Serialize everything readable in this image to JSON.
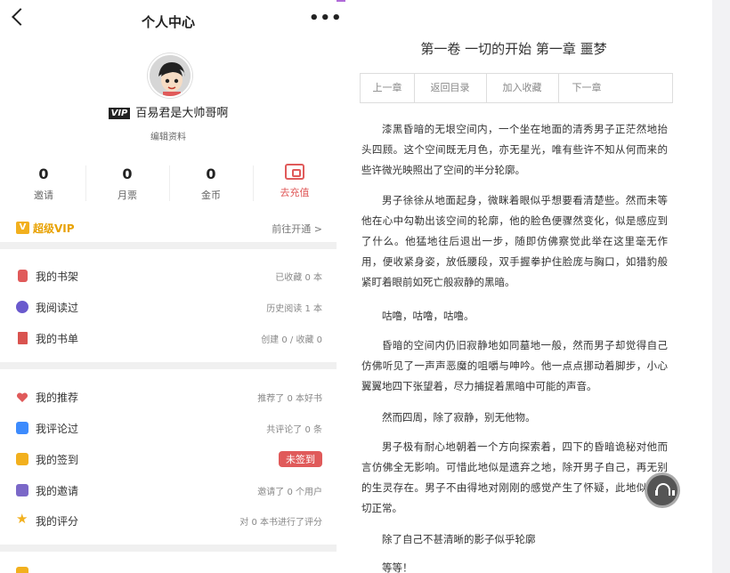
{
  "header": {
    "title": "个人中心"
  },
  "profile": {
    "vip_tag": "VIP",
    "username": "百易君是大帅哥啊",
    "edit_label": "编辑资料"
  },
  "stats": [
    {
      "value": "0",
      "label": "邀请"
    },
    {
      "value": "0",
      "label": "月票"
    },
    {
      "value": "0",
      "label": "金币"
    }
  ],
  "recharge": {
    "label": "去充值"
  },
  "vip": {
    "label": "超级VIP",
    "action": "前往开通 >"
  },
  "menu_group1": [
    {
      "label": "我的书架",
      "value": "已收藏 0 本",
      "icon": "bookshelf-icon",
      "color": "#e05a5a"
    },
    {
      "label": "我阅读过",
      "value": "历史阅读 1 本",
      "icon": "clock-icon",
      "color": "#6a5acd"
    },
    {
      "label": "我的书单",
      "value": "创建 0 / 收藏 0",
      "icon": "bookmark-icon",
      "color": "#d9534f"
    }
  ],
  "menu_group2": [
    {
      "label": "我的推荐",
      "value": "推荐了 0 本好书",
      "icon": "heart-icon",
      "color": "#e05a5a"
    },
    {
      "label": "我评论过",
      "value": "共评论了 0 条",
      "icon": "comment-icon",
      "color": "#3d8bfd"
    },
    {
      "label": "我的签到",
      "value": "未签到",
      "icon": "checkin-icon",
      "color": "#f2b01e"
    },
    {
      "label": "我的邀请",
      "value": "邀请了 0 个用户",
      "icon": "invite-icon",
      "color": "#7b68c8"
    },
    {
      "label": "我的评分",
      "value": "对 0 本书进行了评分",
      "icon": "star-icon",
      "color": "#f2b01e"
    }
  ],
  "reader": {
    "chapter_title": "第一卷 一切的开始 第一章 噩梦",
    "nav": [
      "上一章",
      "返回目录",
      "加入收藏",
      "下一章"
    ],
    "paragraphs": [
      "漆黑昏暗的无垠空间内，一个坐在地面的清秀男子正茫然地抬头四顾。这个空间既无月色，亦无星光，唯有些许不知从何而来的些许微光映照出了空间的半分轮廓。",
      "男子徐徐从地面起身，微眯着眼似乎想要看清楚些。然而未等他在心中勾勒出该空间的轮廓，他的脸色便骤然变化，似是感应到了什么。他猛地往后退出一步，随即仿佛察觉此举在这里毫无作用，便收紧身姿，放低腰段，双手握拳护住脸庞与胸口，如猎豹般紧盯着眼前如死亡般寂静的黑暗。",
      "咕噜，咕噜，咕噜。",
      "昏暗的空间内仍旧寂静地如同墓地一般，然而男子却觉得自己仿佛听见了一声声恶魔的咀嚼与呻吟。他一点点挪动着脚步，小心翼翼地四下张望着，尽力捕捉着黑暗中可能的声音。",
      "然而四周，除了寂静，别无他物。",
      "男子极有耐心地朝着一个方向探索着，四下的昏暗诡秘对他而言仿佛全无影响。可惜此地似是遗弃之地，除开男子自己，再无别的生灵存在。男子不由得地对刚刚的感觉产生了怀疑，此地似乎一切正常。",
      "除了自己不甚清晰的影子似乎轮廓",
      "等等！"
    ]
  },
  "colors": {
    "accent": "#e05a5a",
    "vip": "#e8a100",
    "topline": "#b06ad8"
  }
}
